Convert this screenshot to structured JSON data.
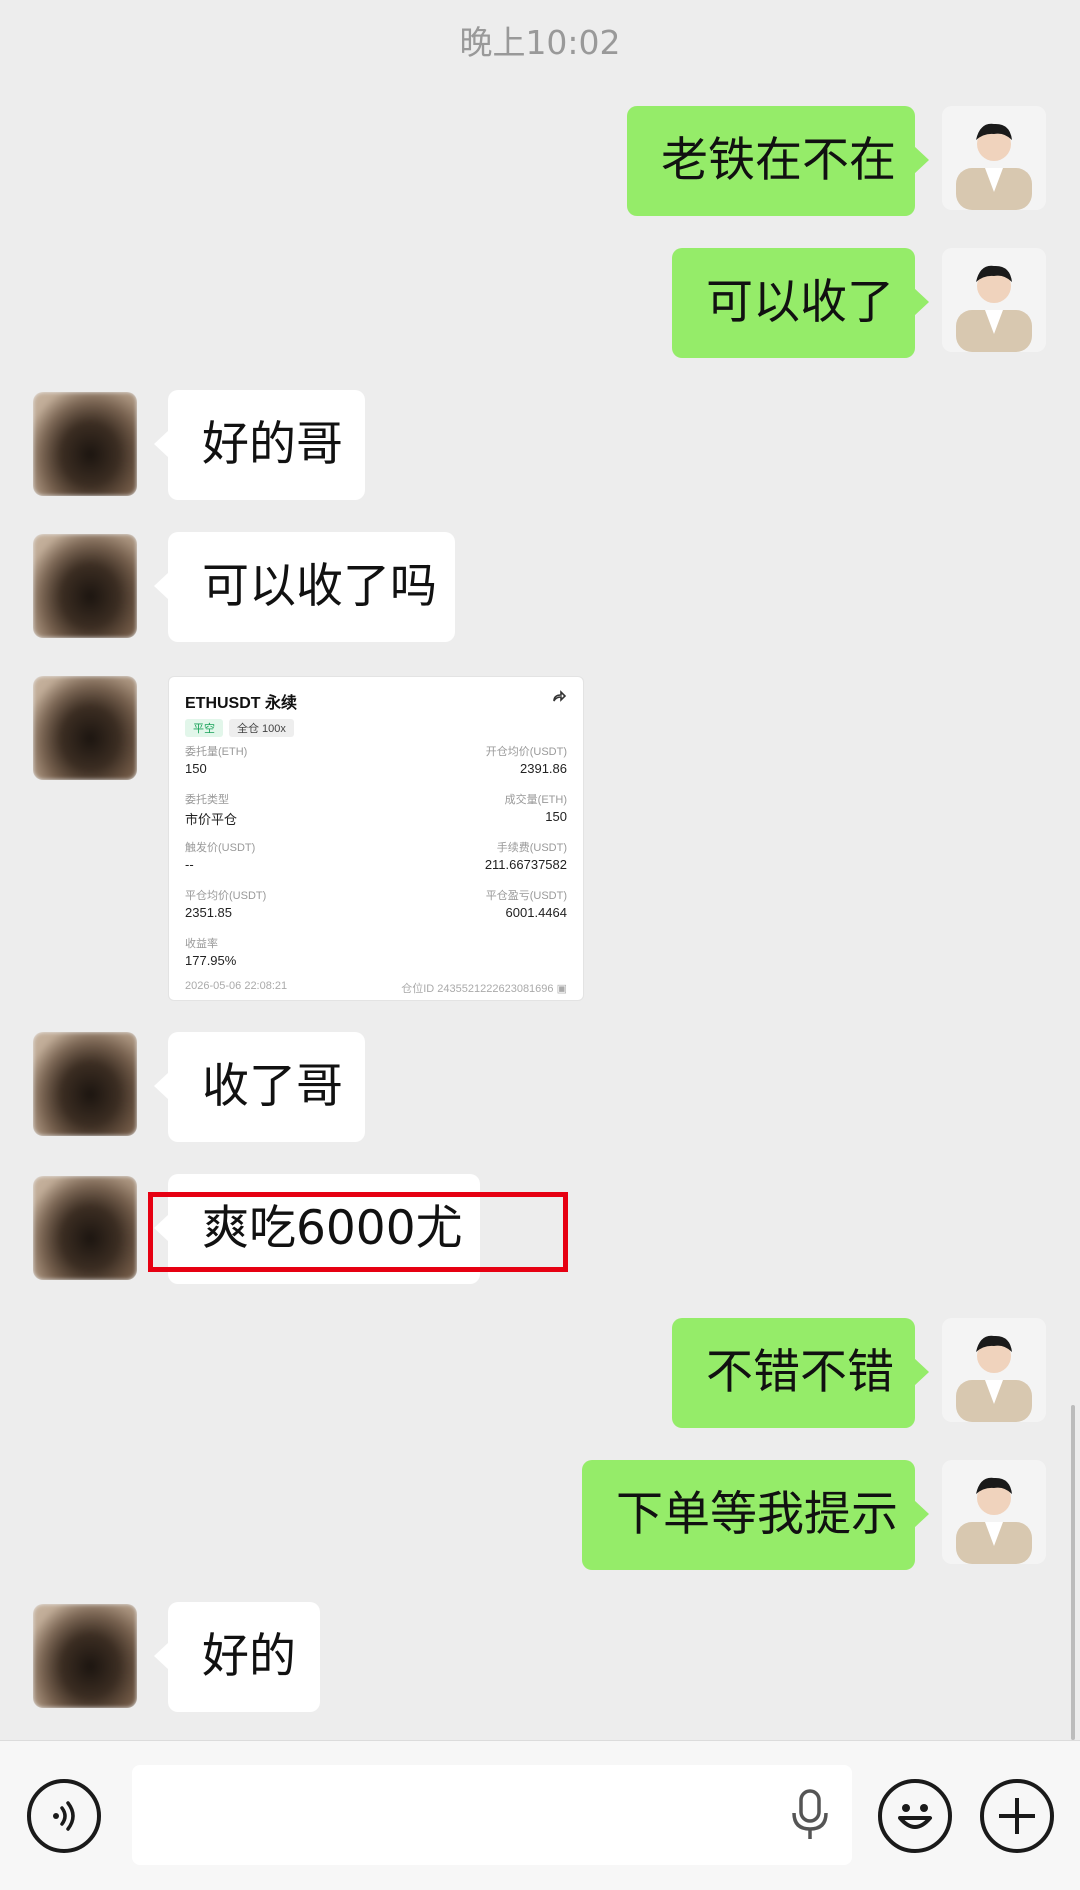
{
  "timestamp": "晚上10:02",
  "messages": [
    {
      "side": "me",
      "text": "老铁在不在"
    },
    {
      "side": "me",
      "text": "可以收了"
    },
    {
      "side": "them",
      "text": "好的哥"
    },
    {
      "side": "them",
      "text": "可以收了吗"
    },
    {
      "side": "them",
      "type": "image"
    },
    {
      "side": "them",
      "text": "收了哥"
    },
    {
      "side": "them",
      "text": "爽吃6000尤"
    },
    {
      "side": "me",
      "text": "不错不错"
    },
    {
      "side": "me",
      "text": "下单等我提示"
    },
    {
      "side": "them",
      "text": "好的"
    }
  ],
  "card": {
    "title": "ETHUSDT 永续",
    "tag_side": "平空",
    "tag_margin": "全仓 100x",
    "rows": [
      {
        "l_label": "委托量(ETH)",
        "l_value": "150",
        "r_label": "开仓均价(USDT)",
        "r_value": "2391.86"
      },
      {
        "l_label": "委托类型",
        "l_value": "市价平仓",
        "r_label": "成交量(ETH)",
        "r_value": "150"
      },
      {
        "l_label": "触发价(USDT)",
        "l_value": "--",
        "r_label": "手续费(USDT)",
        "r_value": "211.66737582"
      },
      {
        "l_label": "平仓均价(USDT)",
        "l_value": "2351.85",
        "r_label": "平仓盈亏(USDT)",
        "r_value": "6001.4464"
      },
      {
        "l_label": "收益率",
        "l_value": "177.95%",
        "r_label": "",
        "r_value": ""
      }
    ],
    "time": "2026-05-06 22:08:21",
    "position_id": "仓位ID 2435521222623081696"
  },
  "input": {
    "placeholder": ""
  },
  "icons": {
    "voice": "voice-icon",
    "mic": "mic-icon",
    "emoji": "emoji-icon",
    "plus": "plus-icon",
    "share": "share-icon",
    "copy": "copy-icon"
  },
  "colors": {
    "background": "#ededed",
    "my_bubble": "#95ec69",
    "their_bubble": "#ffffff",
    "highlight": "#e60012"
  }
}
